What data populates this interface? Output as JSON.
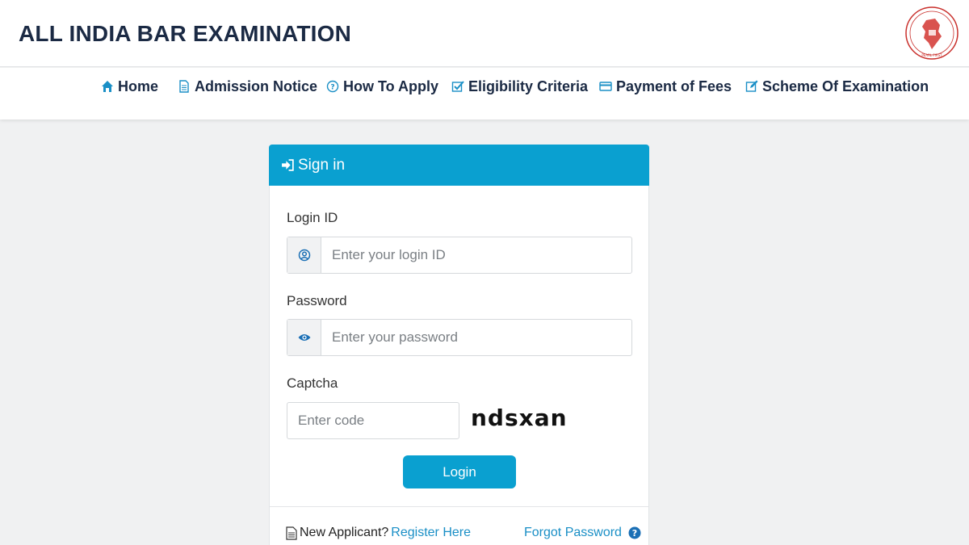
{
  "header": {
    "title": "ALL INDIA BAR EXAMINATION",
    "logo_icon": "bar-council-of-india-seal",
    "logo_text": "BAR COUNCIL OF INDIA TRUST · PEARL FIRST"
  },
  "nav": {
    "items": [
      {
        "label": "Home",
        "icon": "home-icon"
      },
      {
        "label": "Admission Notice",
        "icon": "document-icon"
      },
      {
        "label": "How To Apply",
        "icon": "question-circle-icon"
      },
      {
        "label": "Eligibility Criteria",
        "icon": "checkbox-icon"
      },
      {
        "label": "Payment of Fees",
        "icon": "credit-card-icon"
      },
      {
        "label": "Scheme Of Examination",
        "icon": "edit-icon"
      }
    ]
  },
  "signin": {
    "header_label": "Sign in",
    "login_id_label": "Login ID",
    "login_id_placeholder": "Enter your login ID",
    "password_label": "Password",
    "password_placeholder": "Enter your password",
    "captcha_label": "Captcha",
    "captcha_placeholder": "Enter code",
    "captcha_code": "ndsxan",
    "login_button": "Login",
    "new_applicant_text": "New Applicant?",
    "register_link": "Register Here",
    "forgot_password_link": "Forgot Password"
  },
  "colors": {
    "accent": "#0aa0d0",
    "link": "#1a8fc6",
    "nav_icon": "#1a8fc6",
    "title": "#1b2a44",
    "background": "#f0f1f2"
  }
}
